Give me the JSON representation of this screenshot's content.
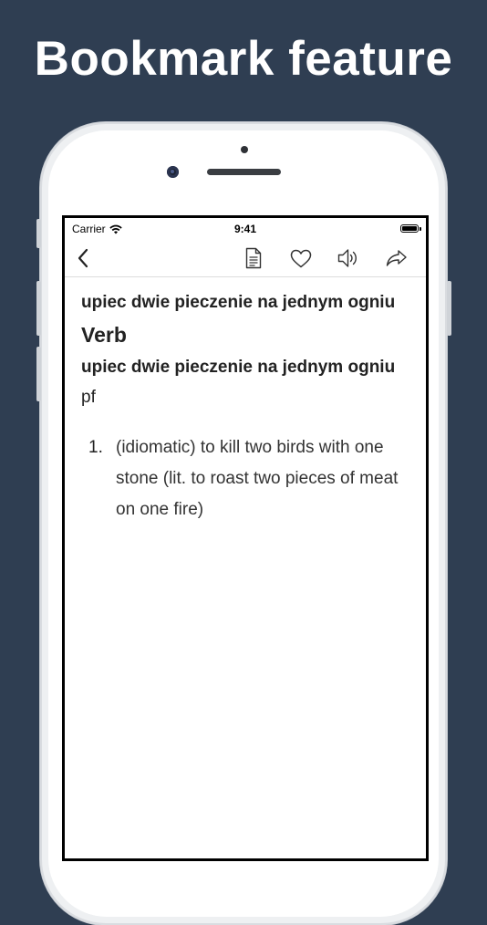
{
  "promo": {
    "headline": "Bookmark feature"
  },
  "status_bar": {
    "carrier": "Carrier",
    "time": "9:41"
  },
  "nav": {
    "back_icon": "chevron-left-icon",
    "icons": [
      "document-icon",
      "heart-icon",
      "speaker-icon",
      "share-icon"
    ]
  },
  "entry": {
    "headword": "upiec dwie pieczenie na jednym ogniu",
    "part_of_speech": "Verb",
    "inflection_head": "upiec dwie pieczenie na jednym ogniu",
    "inflection_suffix": " pf",
    "definitions": [
      {
        "number": "1.",
        "text": "(idiomatic) to kill two birds with one stone (lit. to roast two pieces of meat on one fire)"
      }
    ]
  },
  "colors": {
    "background": "#2f3e52",
    "headline": "#ffffff",
    "text": "#222222"
  }
}
